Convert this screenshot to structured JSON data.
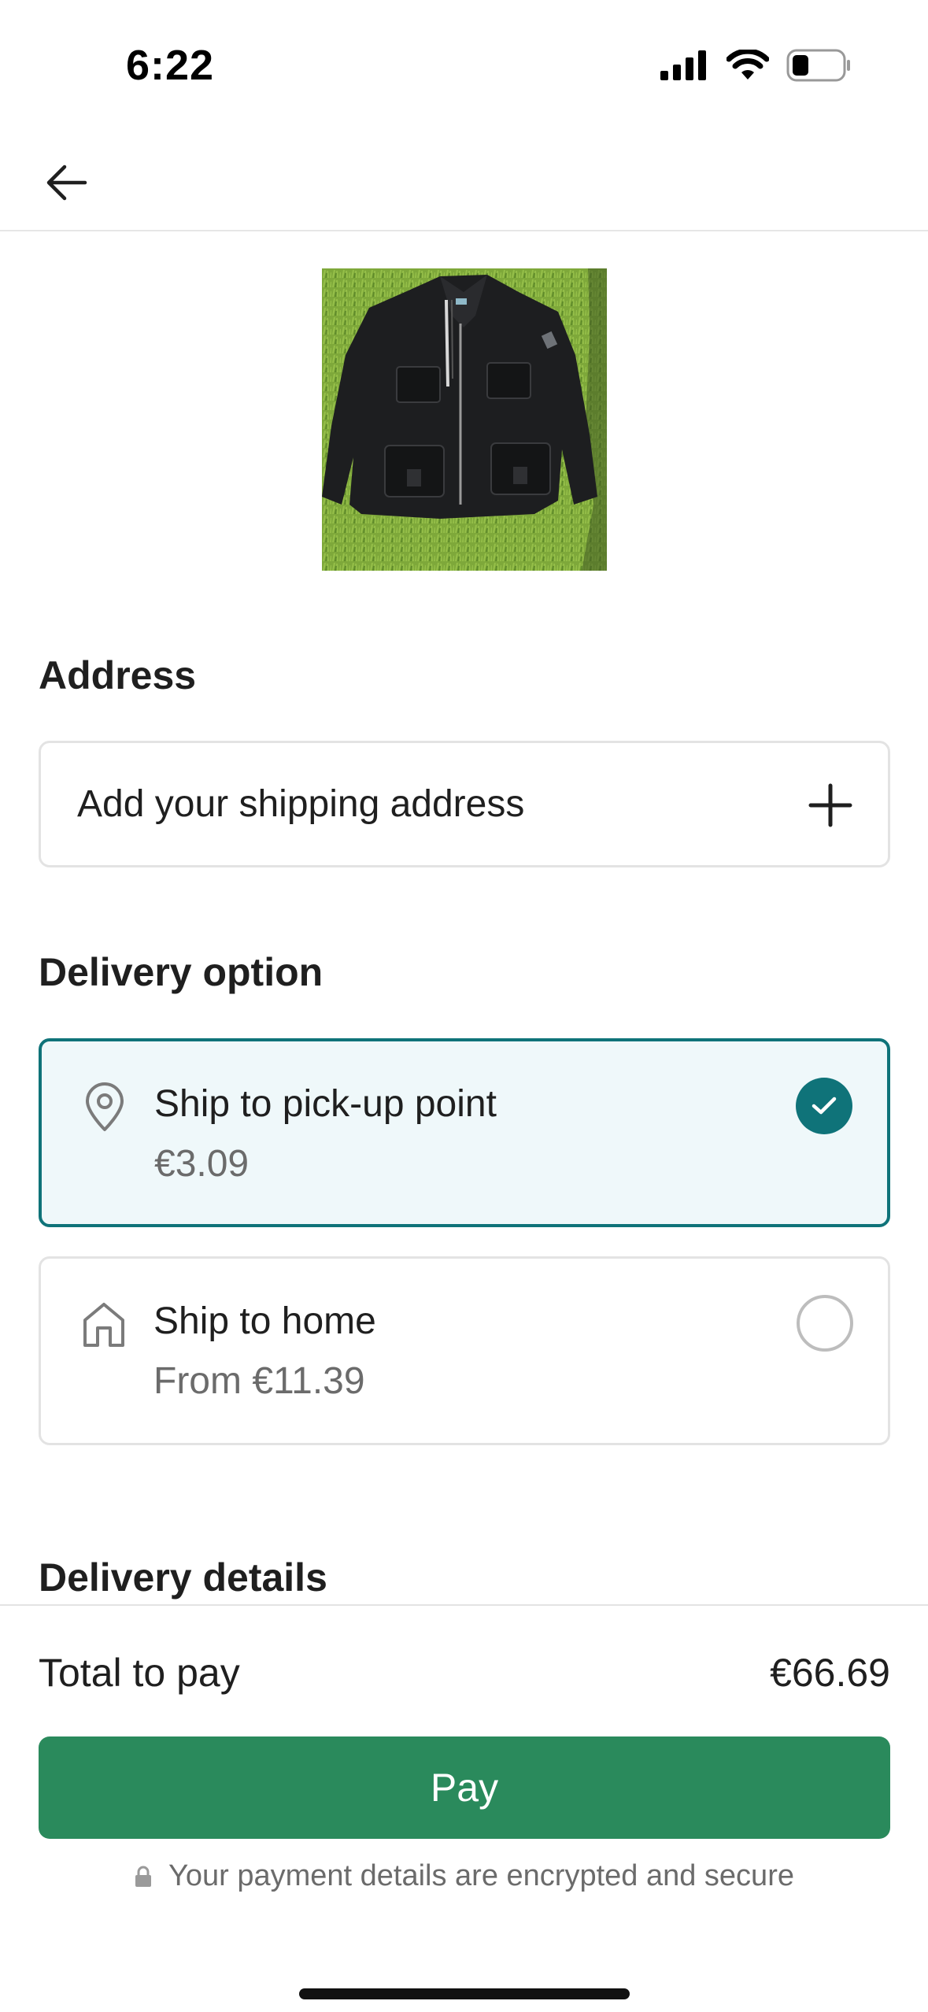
{
  "status_bar": {
    "time": "6:22",
    "icons": [
      "signal-icon",
      "wifi-icon",
      "battery-icon"
    ]
  },
  "nav": {
    "back_icon": "arrow-left-icon"
  },
  "product": {
    "image_icon": "jacket-photo"
  },
  "address": {
    "title": "Address",
    "add_label": "Add your shipping address",
    "add_icon": "plus-icon"
  },
  "delivery": {
    "title": "Delivery option",
    "options": [
      {
        "icon": "location-pin-icon",
        "title": "Ship to pick-up point",
        "price": "€3.09",
        "selected": true
      },
      {
        "icon": "house-icon",
        "title": "Ship to home",
        "price": "From €11.39",
        "selected": false
      }
    ]
  },
  "details": {
    "title": "Delivery details"
  },
  "checkout": {
    "total_label": "Total to pay",
    "total_value": "€66.69",
    "pay_label": "Pay",
    "secure_text": "Your payment details are encrypted and secure"
  },
  "colors": {
    "accent_teal": "#0f7379",
    "selected_bg": "#eff8fa",
    "pay_green": "#2a8a5c"
  }
}
